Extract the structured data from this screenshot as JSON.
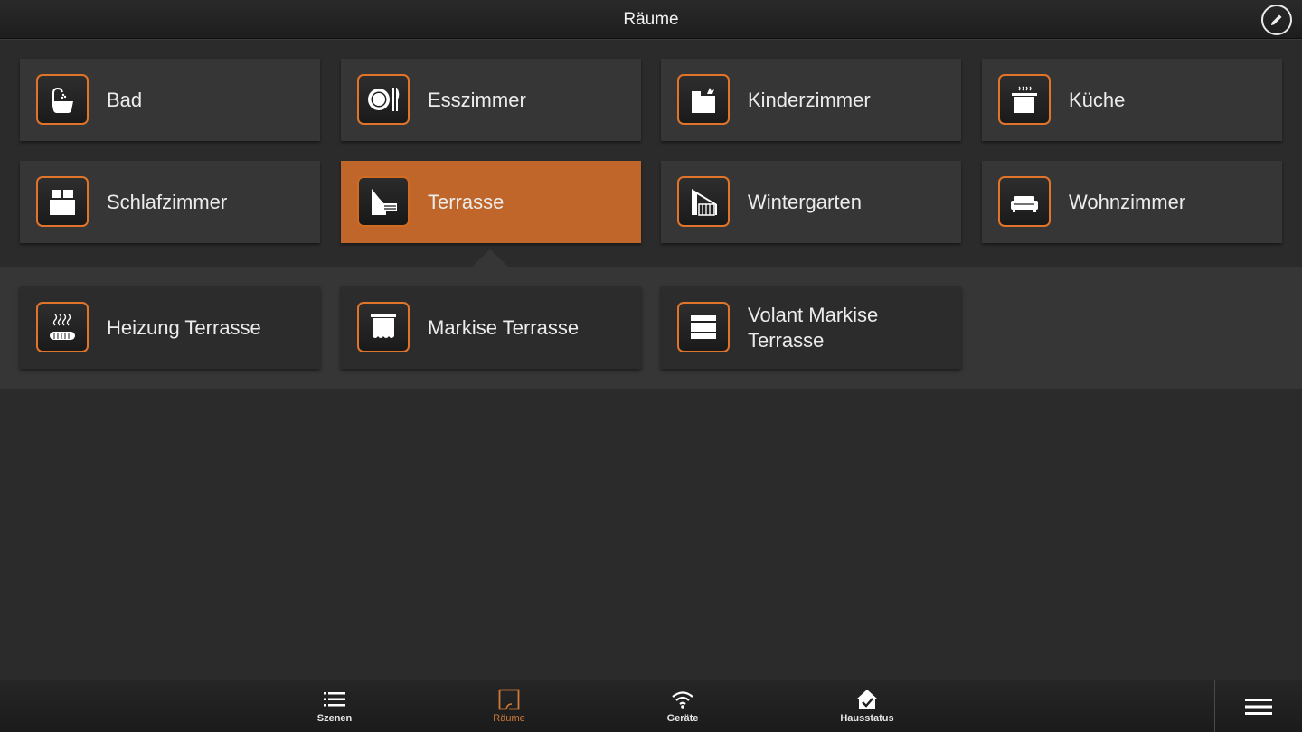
{
  "header": {
    "title": "Räume"
  },
  "rooms": [
    {
      "label": "Bad",
      "icon": "bathtub-icon"
    },
    {
      "label": "Esszimmer",
      "icon": "dining-icon"
    },
    {
      "label": "Kinderzimmer",
      "icon": "toybox-icon"
    },
    {
      "label": "Küche",
      "icon": "cooking-pot-icon"
    },
    {
      "label": "Schlafzimmer",
      "icon": "bed-icon"
    },
    {
      "label": "Terrasse",
      "icon": "terrace-icon",
      "selected": true
    },
    {
      "label": "Wintergarten",
      "icon": "wintergarden-icon"
    },
    {
      "label": "Wohnzimmer",
      "icon": "sofa-icon"
    }
  ],
  "devices": [
    {
      "label": "Heizung Terrasse",
      "icon": "heater-icon"
    },
    {
      "label": "Markise Terrasse",
      "icon": "awning-icon"
    },
    {
      "label": "Volant Markise Terrasse",
      "icon": "valance-awning-icon"
    }
  ],
  "bottom_nav": [
    {
      "label": "Szenen",
      "icon": "list-icon"
    },
    {
      "label": "Räume",
      "icon": "room-icon",
      "active": true
    },
    {
      "label": "Geräte",
      "icon": "wifi-icon"
    },
    {
      "label": "Hausstatus",
      "icon": "house-check-icon"
    }
  ],
  "colors": {
    "accent": "#c1662a",
    "icon_border": "#e0742a",
    "background": "#2b2b2b",
    "tile": "#363636"
  }
}
